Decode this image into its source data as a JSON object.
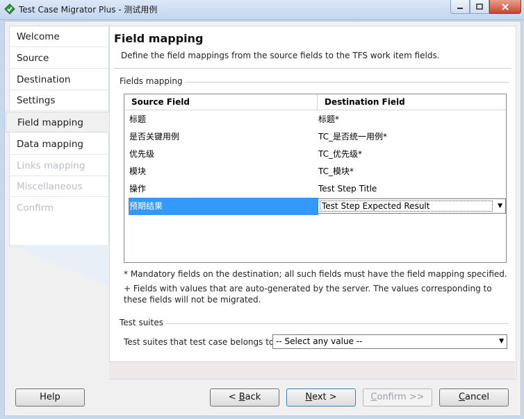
{
  "window": {
    "title": "Test Case Migrator Plus - 测试用例"
  },
  "nav": {
    "items": [
      {
        "label": "Welcome",
        "state": "normal"
      },
      {
        "label": "Source",
        "state": "normal"
      },
      {
        "label": "Destination",
        "state": "normal"
      },
      {
        "label": "Settings",
        "state": "normal"
      },
      {
        "label": "Field mapping",
        "state": "selected"
      },
      {
        "label": "Data mapping",
        "state": "normal"
      },
      {
        "label": "Links mapping",
        "state": "disabled"
      },
      {
        "label": "Miscellaneous",
        "state": "disabled"
      },
      {
        "label": "Confirm",
        "state": "disabled"
      }
    ]
  },
  "page": {
    "title": "Field mapping",
    "description": "Define the field mappings from the source fields to the TFS work item fields."
  },
  "fields_group": {
    "label": "Fields mapping",
    "columns": {
      "source": "Source Field",
      "destination": "Destination Field"
    },
    "rows": [
      {
        "source": "标题",
        "destination": "标题*"
      },
      {
        "source": "是否关键用例",
        "destination": "TC_是否统一用例*"
      },
      {
        "source": "优先级",
        "destination": "TC_优先级*"
      },
      {
        "source": "模块",
        "destination": "TC_模块*"
      },
      {
        "source": "操作",
        "destination": "Test Step Title"
      },
      {
        "source": "预期结果",
        "destination": "Test Step Expected Result",
        "selected": true
      }
    ],
    "note_mandatory": "* Mandatory fields on the destination; all such fields must have the field mapping specified.",
    "note_autogen": "+ Fields with values that are auto-generated by the server. The values corresponding to these fields will not be migrated."
  },
  "suites_group": {
    "label": "Test suites",
    "prompt": "Test suites that test case belongs to:",
    "selected": "-- Select any value --"
  },
  "buttons": {
    "help": "Help",
    "back_prefix": "< ",
    "back_key": "B",
    "back_rest": "ack",
    "next_key": "N",
    "next_rest": "ext >",
    "confirm_key": "C",
    "confirm_rest": "onfirm >>",
    "cancel_key": "C",
    "cancel_rest": "ancel"
  },
  "colors": {
    "selection": "#3399ff",
    "disabled_text": "#b8bec8"
  }
}
